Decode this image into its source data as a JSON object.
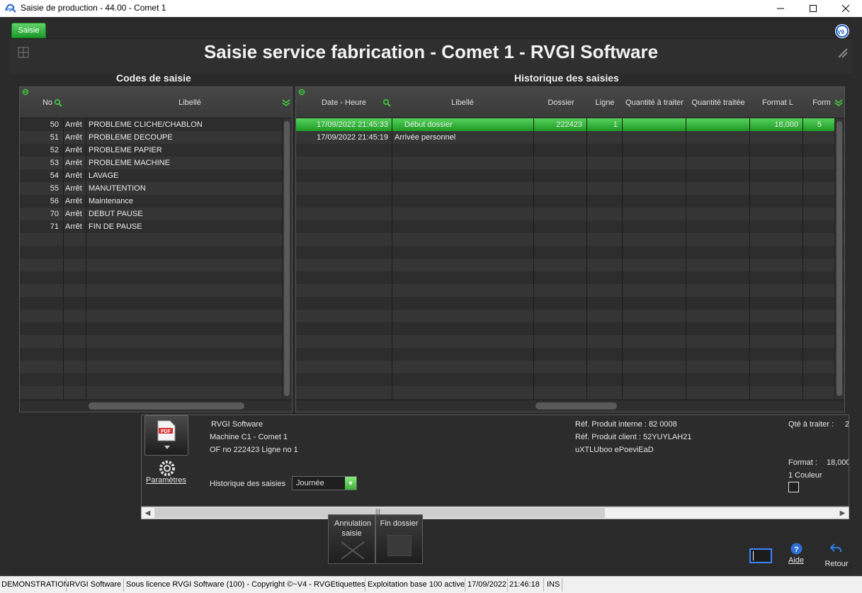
{
  "window": {
    "title": "Saisie de production - 44.00 -  Comet 1"
  },
  "app": {
    "tab_label": "Saisie",
    "page_title": "Saisie service fabrication - Comet 1 -  RVGI Software"
  },
  "codes": {
    "section_title": "Codes de saisie",
    "columns": [
      "No",
      "Libellé"
    ],
    "rows": [
      {
        "no": "50",
        "type": "Arrêt",
        "libelle": "PROBLEME CLICHE/CHABLON"
      },
      {
        "no": "51",
        "type": "Arrêt",
        "libelle": "PROBLEME DECOUPE"
      },
      {
        "no": "52",
        "type": "Arrêt",
        "libelle": "PROBLEME PAPIER"
      },
      {
        "no": "53",
        "type": "Arrêt",
        "libelle": "PROBLEME MACHINE"
      },
      {
        "no": "54",
        "type": "Arrêt",
        "libelle": "LAVAGE"
      },
      {
        "no": "55",
        "type": "Arrêt",
        "libelle": "MANUTENTION"
      },
      {
        "no": "56",
        "type": "Arrêt",
        "libelle": "Maintenance"
      },
      {
        "no": "70",
        "type": "Arrêt",
        "libelle": "DEBUT PAUSE"
      },
      {
        "no": "71",
        "type": "Arrêt",
        "libelle": "FIN DE PAUSE"
      }
    ]
  },
  "historique": {
    "section_title": "Historique des saisies",
    "columns": [
      "Date - Heure",
      "Libellé",
      "Dossier",
      "Ligne",
      "Quantité à traiter",
      "Quantité traitée",
      "Format L",
      "Form"
    ],
    "rows": [
      {
        "date": "17/09/2022 21:45:33",
        "libelle": "Début dossier",
        "dossier": "222423",
        "ligne": "1",
        "qte_a_traiter": "",
        "qte_traitee": "",
        "format_l": "18,000",
        "form": "5",
        "selected": true
      },
      {
        "date": "17/09/2022 21:45:19",
        "libelle": "Arrivée personnel",
        "dossier": "",
        "ligne": "",
        "qte_a_traiter": "",
        "qte_traitee": "",
        "format_l": "",
        "form": "",
        "selected": false
      }
    ]
  },
  "info": {
    "company": "RVGI Software",
    "machine": "Machine C1 - Comet 1",
    "of_line": "OF no 222423 Ligne no 1",
    "ref_interne": "Réf. Produit interne : 82 0008",
    "ref_client": "Réf. Produit client : 52YUYLAH21",
    "code": "uXTLUboo ePoeviEaD",
    "qte_label": "Qté à traiter :",
    "qte_value": "2",
    "format_label": "Format :",
    "format_value": "18,000",
    "couleur": "1 Couleur",
    "parametres_label": "Paramètres",
    "historique_label": "Historique des saisies",
    "historique_select": "Journée"
  },
  "buttons": {
    "annulation": "Annulation saisie",
    "fin_dossier": "Fin  dossier",
    "aide": "Aide",
    "retour": "Retour"
  },
  "statusbar": {
    "segments": [
      "DEMONSTRATION",
      "RVGI Software",
      "Sous licence RVGI Software (100) - Copyright ©~V4 - RVGEtiquettes",
      "Exploitation base 100 active",
      "17/09/2022",
      "21:46:18",
      "INS"
    ]
  },
  "colors": {
    "accent_green": "#2fb335",
    "background": "#2a2a2a"
  }
}
